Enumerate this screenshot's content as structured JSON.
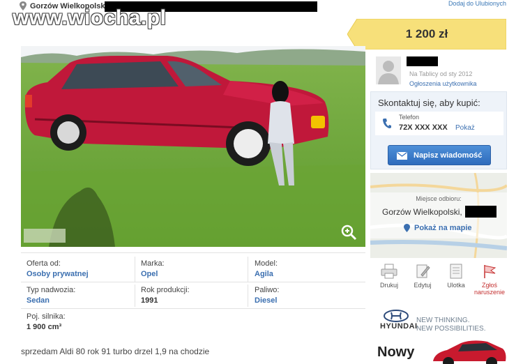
{
  "header": {
    "location": "Gorzów Wielkopolski",
    "favorite_link": "Dodaj do Ulubionych",
    "watermark": "www.wiocha.pl"
  },
  "price": "1 200 zł",
  "seller": {
    "since": "Na Tablicy od sty 2012",
    "ads_link": "Ogłoszenia użytkownika"
  },
  "contact": {
    "title": "Skontaktuj się, aby kupić:",
    "phone_label": "Telefon",
    "phone_number": "72X XXX XXX",
    "phone_show": "Pokaż",
    "message_button": "Napisz wiadomość"
  },
  "map": {
    "label": "Miejsce odbioru:",
    "place": "Gorzów Wielkopolski,",
    "show_link": "Pokaż na mapie"
  },
  "tools": [
    {
      "label": "Drukuj",
      "icon": "printer-icon"
    },
    {
      "label": "Edytuj",
      "icon": "edit-icon"
    },
    {
      "label": "Ulotka",
      "icon": "flyer-icon"
    },
    {
      "label": "Zgłoś naruszenie",
      "icon": "flag-icon"
    }
  ],
  "details": {
    "offer_label": "Oferta od:",
    "offer_value": "Osoby prywatnej",
    "make_label": "Marka:",
    "make_value": "Opel",
    "model_label": "Model:",
    "model_value": "Agila",
    "body_label": "Typ nadwozia:",
    "body_value": "Sedan",
    "year_label": "Rok produkcji:",
    "year_value": "1991",
    "fuel_label": "Paliwo:",
    "fuel_value": "Diesel",
    "engine_label": "Poj. silnika:",
    "engine_value": "1 900 cm³"
  },
  "description": "sprzedam Aldi 80 rok 91 turbo drzel 1,9 na chodzie",
  "ad": {
    "brand": "HYUNDAI",
    "slogan1": "NEW THINKING.",
    "slogan2": "NEW POSSIBILITIES.",
    "headline": "Nowy"
  },
  "colors": {
    "accent_link": "#3b6fb0",
    "price_badge": "#f7e07a",
    "button": "#2f6cbd",
    "car": "#c0183a"
  }
}
